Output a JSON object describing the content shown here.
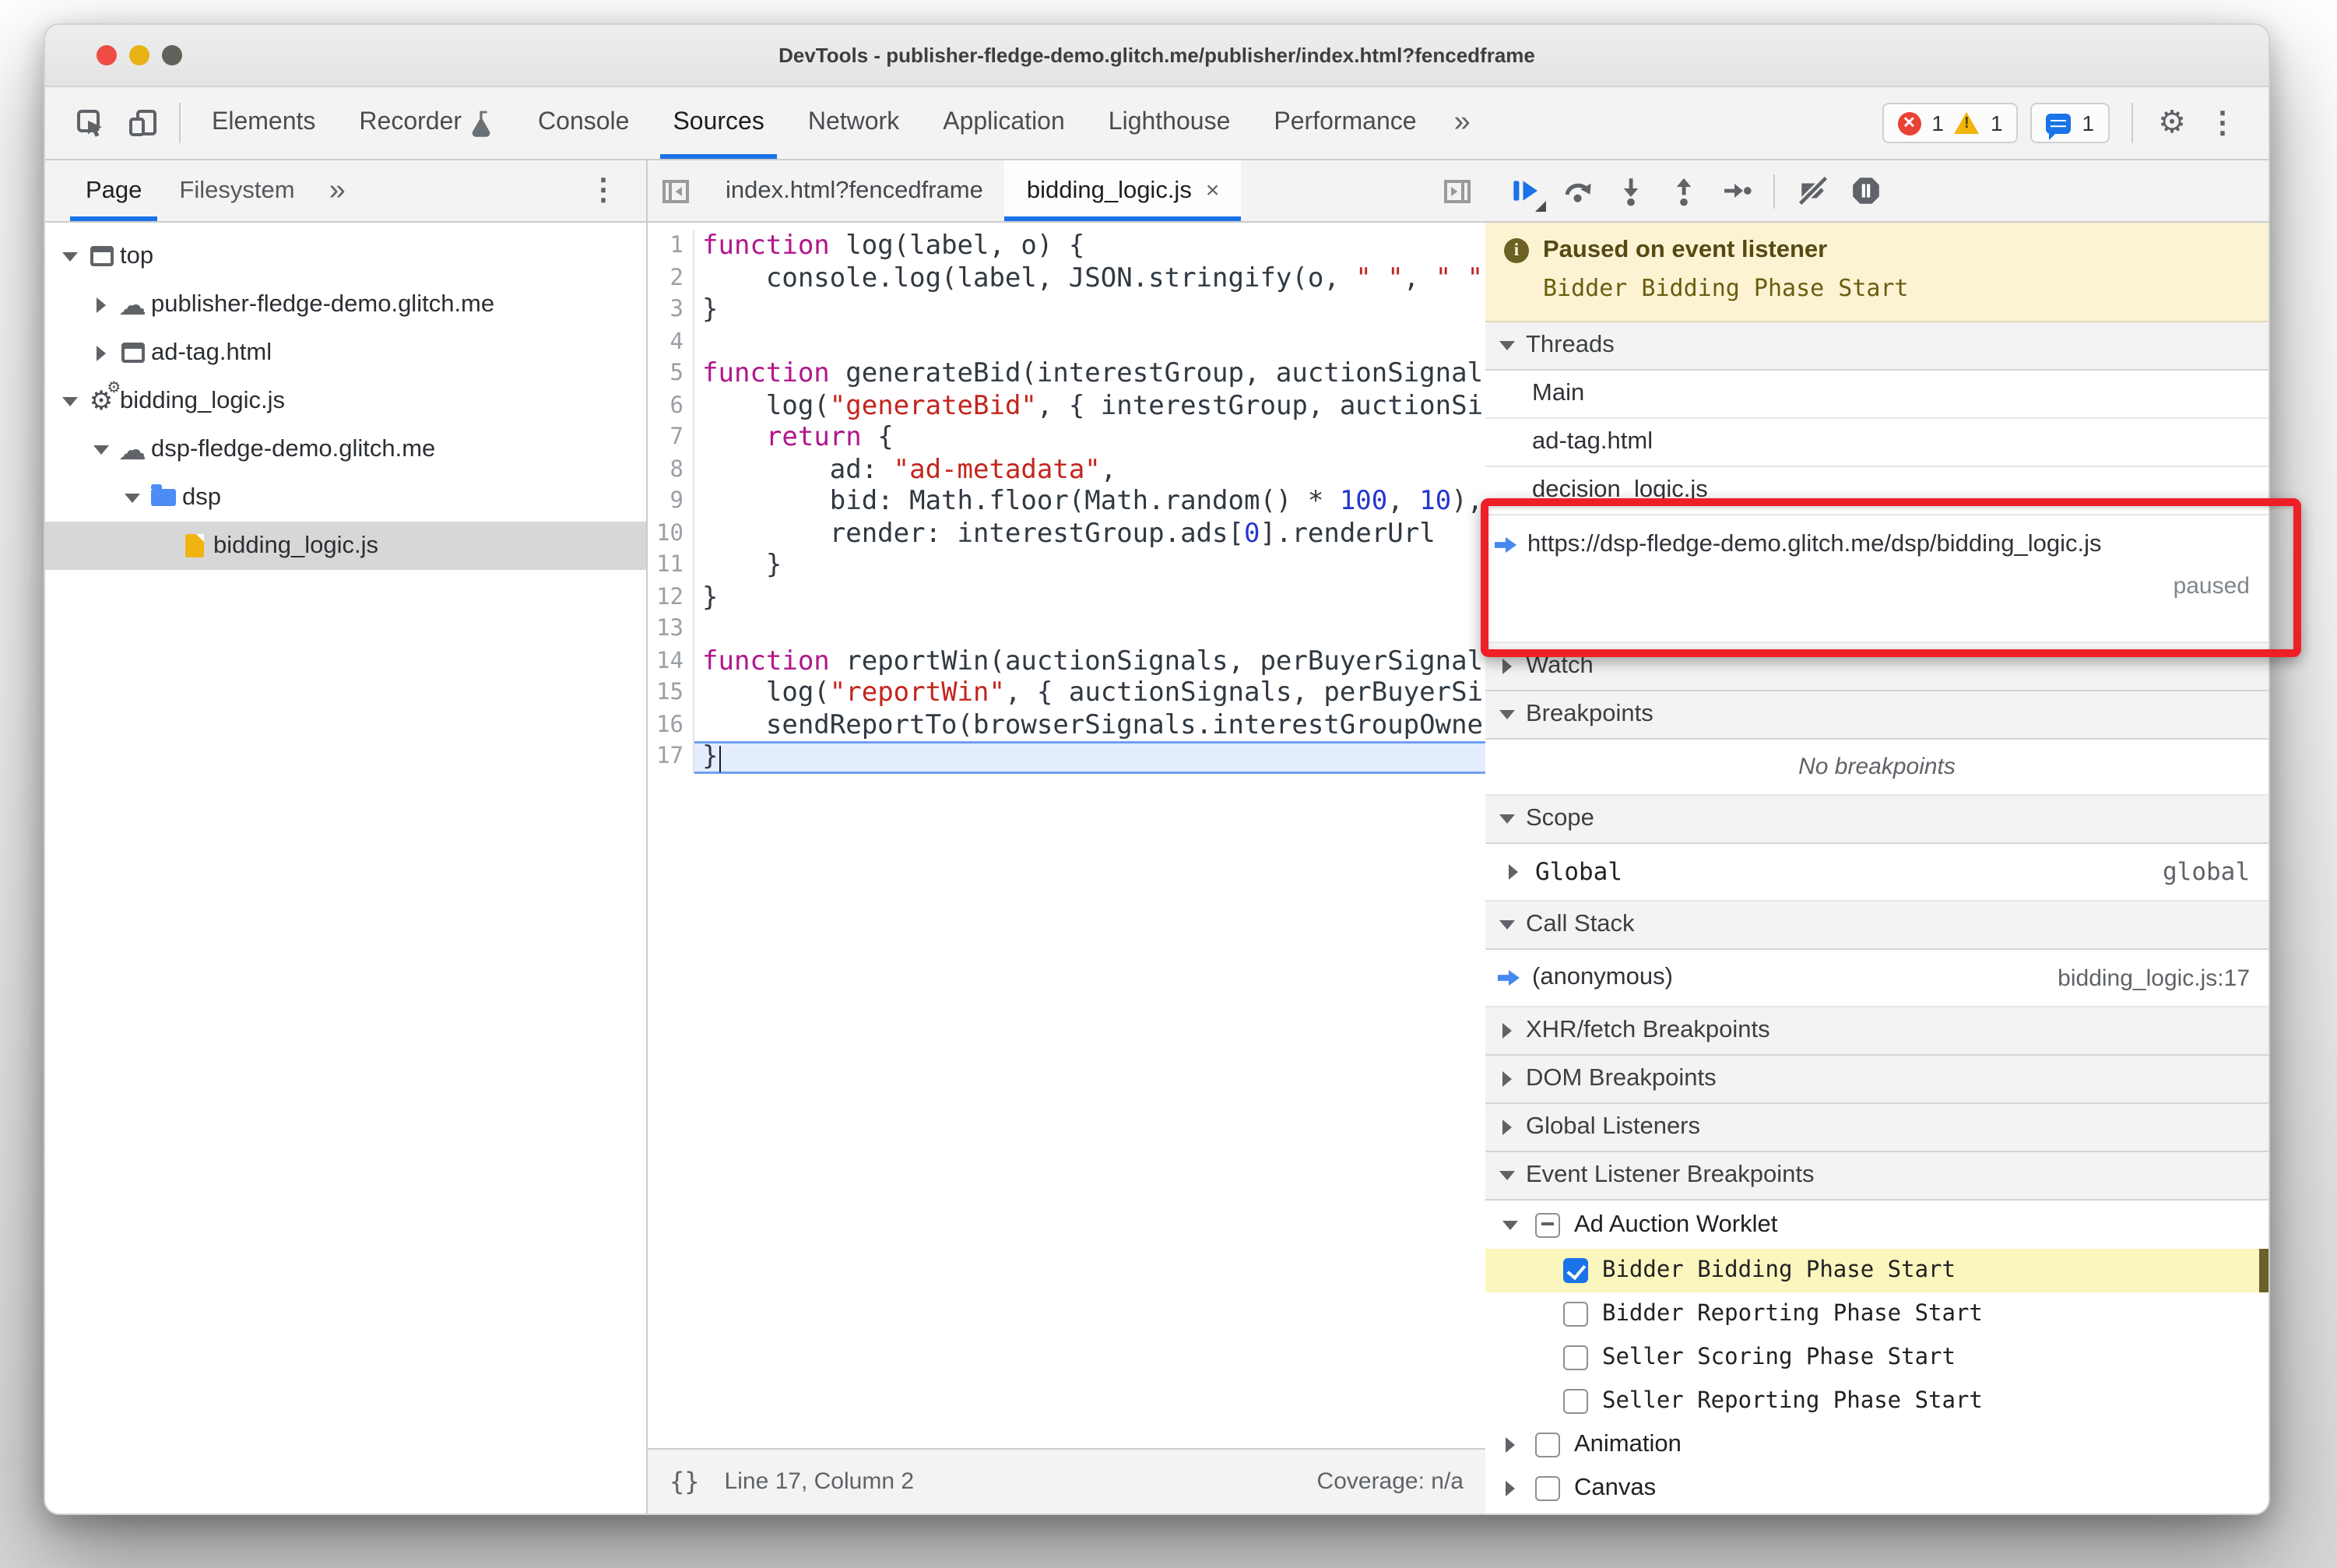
{
  "window": {
    "title": "DevTools - publisher-fledge-demo.glitch.me/publisher/index.html?fencedframe"
  },
  "colors": {
    "accent_blue": "#1a73e8",
    "annotation_red": "#ee1f26",
    "paused_banner_bg": "#fcf3d3",
    "exec_arrow_blue": "#4688f1",
    "folder_blue": "#4d8cf5",
    "file_yellow": "#f0b310",
    "listener_highlight_yellow": "#fbf6bd"
  },
  "main_toolbar": {
    "tabs": [
      {
        "label": "Elements"
      },
      {
        "label": "Recorder",
        "flask": true
      },
      {
        "label": "Console"
      },
      {
        "label": "Sources",
        "active": true
      },
      {
        "label": "Network"
      },
      {
        "label": "Application"
      },
      {
        "label": "Lighthouse"
      },
      {
        "label": "Performance"
      }
    ],
    "more_tabs": "»",
    "badges": {
      "errors": "1",
      "warnings": "1",
      "issues": "1"
    }
  },
  "sidebar": {
    "tabs": [
      {
        "label": "Page",
        "active": true
      },
      {
        "label": "Filesystem"
      }
    ],
    "more_tabs": "»",
    "menu": "⋮",
    "tree": [
      {
        "label": "top",
        "icon": "frame",
        "arrow": "down",
        "depth": 0
      },
      {
        "label": "publisher-fledge-demo.glitch.me",
        "icon": "cloud",
        "arrow": "right",
        "depth": 1
      },
      {
        "label": "ad-tag.html",
        "icon": "frame",
        "arrow": "right",
        "depth": 1
      },
      {
        "label": "bidding_logic.js",
        "icon": "worker",
        "arrow": "down",
        "depth": 0
      },
      {
        "label": "dsp-fledge-demo.glitch.me",
        "icon": "cloud",
        "arrow": "down",
        "depth": 1
      },
      {
        "label": "dsp",
        "icon": "folder",
        "arrow": "down",
        "depth": 2
      },
      {
        "label": "bidding_logic.js",
        "icon": "filejs",
        "arrow": "none",
        "depth": 3,
        "selected": true
      }
    ]
  },
  "editor": {
    "tabs": [
      {
        "label": "index.html?fencedframe"
      },
      {
        "label": "bidding_logic.js",
        "active": true,
        "close": "×"
      }
    ],
    "code_lines": [
      {
        "n": 1,
        "tokens": [
          [
            "kw",
            "function"
          ],
          [
            "pl",
            " log(label, o) {"
          ]
        ]
      },
      {
        "n": 2,
        "tokens": [
          [
            "pl",
            "    console.log(label, JSON.stringify(o, "
          ],
          [
            "str",
            "\" \""
          ],
          [
            "pl",
            ", "
          ],
          [
            "str",
            "\" \""
          ]
        ]
      },
      {
        "n": 3,
        "tokens": [
          [
            "pl",
            "}"
          ]
        ]
      },
      {
        "n": 4,
        "tokens": []
      },
      {
        "n": 5,
        "tokens": [
          [
            "kw",
            "function"
          ],
          [
            "pl",
            " generateBid(interestGroup, auctionSignal"
          ]
        ]
      },
      {
        "n": 6,
        "tokens": [
          [
            "pl",
            "    log("
          ],
          [
            "str",
            "\"generateBid\""
          ],
          [
            "pl",
            ", { interestGroup, auctionSi"
          ]
        ]
      },
      {
        "n": 7,
        "tokens": [
          [
            "pl",
            "    "
          ],
          [
            "kw",
            "return"
          ],
          [
            "pl",
            " {"
          ]
        ]
      },
      {
        "n": 8,
        "tokens": [
          [
            "pl",
            "        ad: "
          ],
          [
            "str",
            "\"ad-metadata\""
          ],
          [
            "pl",
            ","
          ]
        ]
      },
      {
        "n": 9,
        "tokens": [
          [
            "pl",
            "        bid: Math.floor(Math.random() * "
          ],
          [
            "num",
            "100"
          ],
          [
            "pl",
            ", "
          ],
          [
            "num",
            "10"
          ],
          [
            "pl",
            "),"
          ]
        ]
      },
      {
        "n": 10,
        "tokens": [
          [
            "pl",
            "        render: interestGroup.ads["
          ],
          [
            "num",
            "0"
          ],
          [
            "pl",
            "].renderUrl"
          ]
        ]
      },
      {
        "n": 11,
        "tokens": [
          [
            "pl",
            "    }"
          ]
        ]
      },
      {
        "n": 12,
        "tokens": [
          [
            "pl",
            "}"
          ]
        ]
      },
      {
        "n": 13,
        "tokens": []
      },
      {
        "n": 14,
        "tokens": [
          [
            "kw",
            "function"
          ],
          [
            "pl",
            " reportWin(auctionSignals, perBuyerSignal"
          ]
        ]
      },
      {
        "n": 15,
        "tokens": [
          [
            "pl",
            "    log("
          ],
          [
            "str",
            "\"reportWin\""
          ],
          [
            "pl",
            ", { auctionSignals, perBuyerSi"
          ]
        ]
      },
      {
        "n": 16,
        "tokens": [
          [
            "pl",
            "    sendReportTo(browserSignals.interestGroupOwne"
          ]
        ]
      },
      {
        "n": 17,
        "tokens": [
          [
            "pl",
            "}"
          ]
        ],
        "exec": true
      }
    ],
    "status": {
      "braces": "{}",
      "position": "Line 17, Column 2",
      "coverage": "Coverage: n/a"
    }
  },
  "debugger": {
    "toolbar_icons": [
      "resume",
      "step-over",
      "step-into",
      "step-out",
      "step",
      "deactivate-breakpoints",
      "pause-on-exceptions"
    ],
    "banner": {
      "title": "Paused on event listener",
      "detail": "Bidder Bidding Phase Start"
    },
    "rows": [
      {
        "type": "header",
        "label": "Threads",
        "arrow": "down"
      },
      {
        "type": "item",
        "label": "Main"
      },
      {
        "type": "item",
        "label": "ad-tag.html"
      },
      {
        "type": "item",
        "label": "decision_logic.js"
      },
      {
        "type": "thread-paused",
        "label": "https://dsp-fledge-demo.glitch.me/dsp/bidding_logic.js",
        "status": "paused"
      },
      {
        "type": "header",
        "label": "Watch",
        "arrow": "right"
      },
      {
        "type": "header",
        "label": "Breakpoints",
        "arrow": "down"
      },
      {
        "type": "empty",
        "label": "No breakpoints"
      },
      {
        "type": "header",
        "label": "Scope",
        "arrow": "down"
      },
      {
        "type": "scope-row",
        "label": "Global",
        "value": "global",
        "arrow": "right"
      },
      {
        "type": "header",
        "label": "Call Stack",
        "arrow": "down"
      },
      {
        "type": "stack-row",
        "label": "(anonymous)",
        "location": "bidding_logic.js:17",
        "current": true
      },
      {
        "type": "header",
        "label": "XHR/fetch Breakpoints",
        "arrow": "right"
      },
      {
        "type": "header",
        "label": "DOM Breakpoints",
        "arrow": "right"
      },
      {
        "type": "header",
        "label": "Global Listeners",
        "arrow": "right"
      },
      {
        "type": "header",
        "label": "Event Listener Breakpoints",
        "arrow": "down"
      },
      {
        "type": "listener-category",
        "label": "Ad Auction Worklet",
        "arrow": "down",
        "checkbox": "indeterminate"
      },
      {
        "type": "listener-event",
        "label": "Bidder Bidding Phase Start",
        "checkbox": "checked",
        "highlight": true
      },
      {
        "type": "listener-event",
        "label": "Bidder Reporting Phase Start",
        "checkbox": "unchecked"
      },
      {
        "type": "listener-event",
        "label": "Seller Scoring Phase Start",
        "checkbox": "unchecked"
      },
      {
        "type": "listener-category",
        "label": "Seller Reporting Phase Start",
        "checkbox": "unchecked",
        "arrow": "none",
        "event_style": true
      },
      {
        "type": "listener-category",
        "label": "Animation",
        "arrow": "right",
        "checkbox": "unchecked",
        "small": true
      },
      {
        "type": "listener-category",
        "label": "Canvas",
        "arrow": "right",
        "checkbox": "unchecked",
        "small": true
      }
    ]
  }
}
